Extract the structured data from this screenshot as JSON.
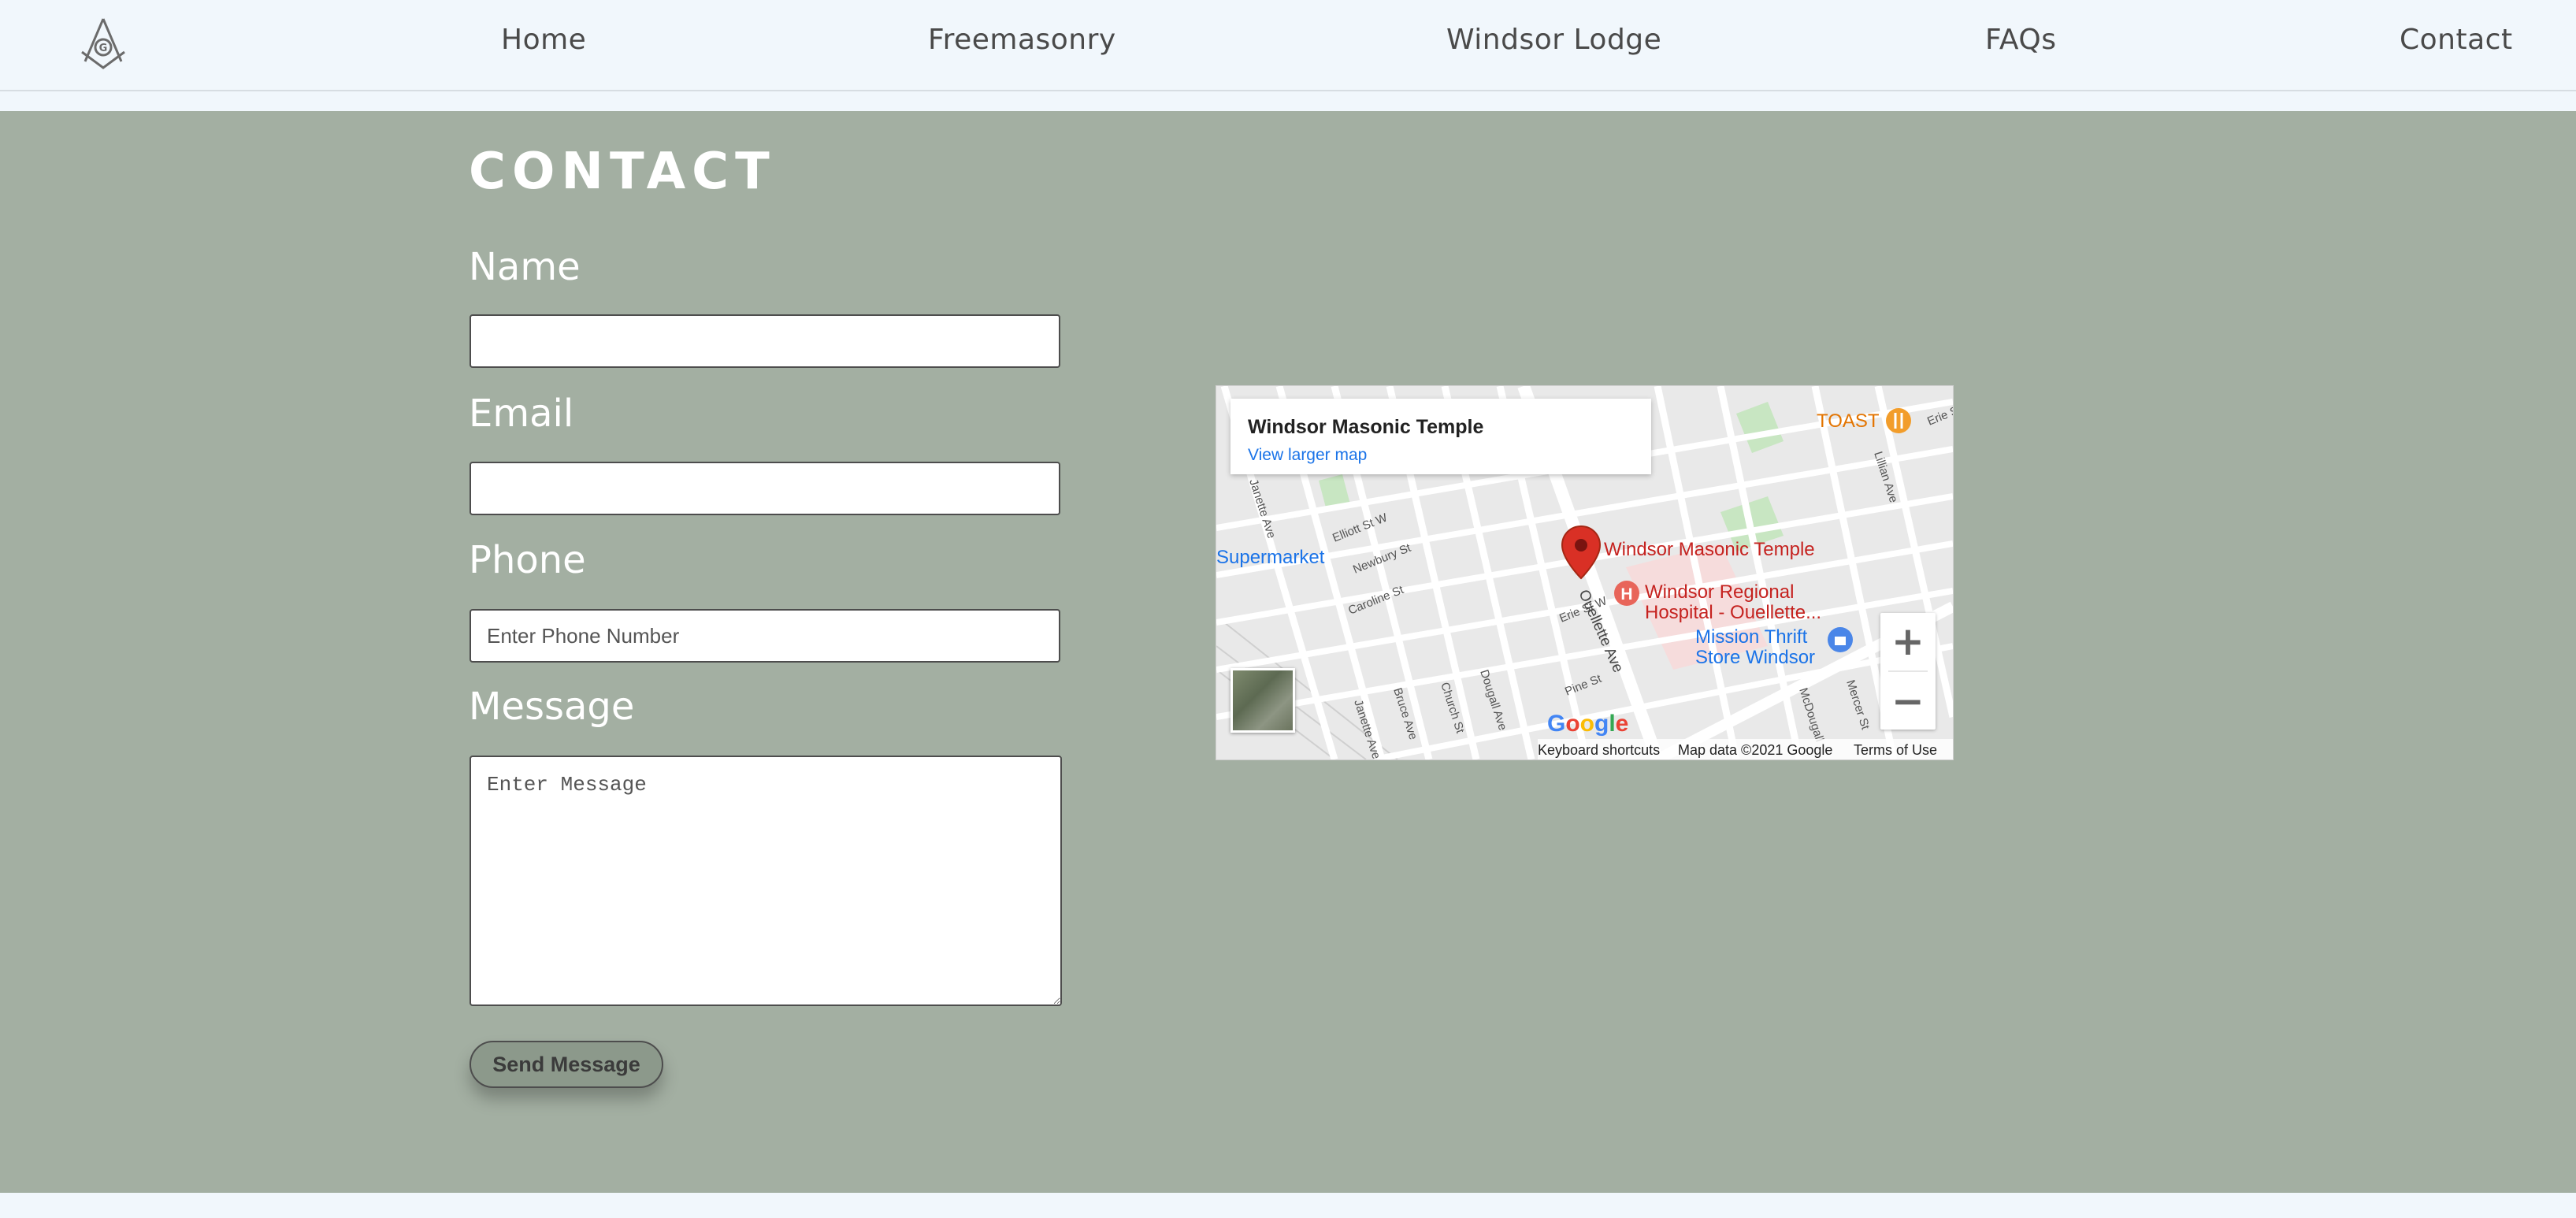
{
  "nav": {
    "logo": "square-and-compass-logo",
    "items": [
      {
        "label": "Home"
      },
      {
        "label": "Freemasonry"
      },
      {
        "label": "Windsor Lodge"
      },
      {
        "label": "FAQs"
      },
      {
        "label": "Contact"
      }
    ]
  },
  "form": {
    "title": "CONTACT",
    "name_label": "Name",
    "name_value": "",
    "email_label": "Email",
    "email_value": "",
    "phone_label": "Phone",
    "phone_placeholder": "Enter Phone Number",
    "message_label": "Message",
    "message_placeholder": "Enter Message",
    "send_label": "Send Message"
  },
  "map": {
    "card_title": "Windsor Masonic Temple",
    "card_link": "View larger map",
    "place_label": "Windsor Masonic Temple",
    "hospital_label_line1": "Windsor Regional",
    "hospital_label_line2": "Hospital -  Ouellette...",
    "store_label_line1": "Mission Thrift",
    "store_label_line2": "Store Windsor",
    "restaurant_label": "TOAST",
    "supermarket_label": "Supermarket",
    "streets": [
      "Elliott St W",
      "Newbury St",
      "Caroline St",
      "Erie St W",
      "Pine St",
      "Ouellette Ave",
      "Janette Ave",
      "Bruce Ave",
      "Church St",
      "Dougall Ave",
      "Lillian Ave",
      "McDougall",
      "Mercer St",
      "Erie St"
    ],
    "zoom_in": "+",
    "zoom_out": "−",
    "google": "Google",
    "attribution": {
      "shortcuts": "Keyboard shortcuts",
      "data": "Map data ©2021 Google",
      "terms": "Terms of Use"
    },
    "colors": {
      "place_pin": "#d93025",
      "blue_poi": "#1a73e8",
      "orange_poi": "#e37400"
    }
  },
  "colors": {
    "nav_bg": "#f1f7fc",
    "main_bg": "#a3afa2",
    "button_bg": "#8c998b"
  }
}
